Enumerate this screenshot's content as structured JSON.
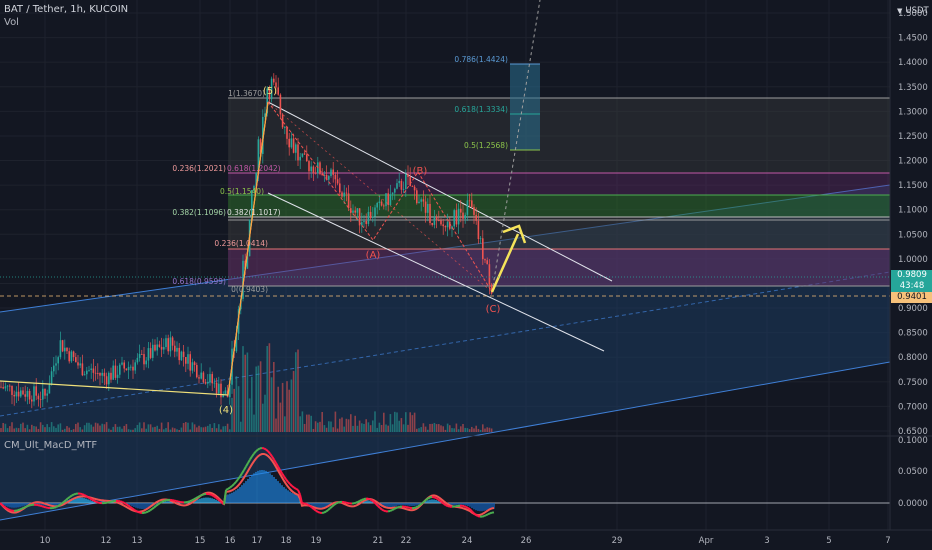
{
  "header": {
    "symbol_line": "BAT / Tether, 1h, KUCOIN",
    "vol_label": "Vol",
    "indicator_label": "CM_Ult_MacD_MTF"
  },
  "price_axis": {
    "currency": "USDT",
    "ticks": [
      "1.5000",
      "1.4500",
      "1.4000",
      "1.3500",
      "1.3000",
      "1.2500",
      "1.2000",
      "1.1500",
      "1.1000",
      "1.0500",
      "1.0000",
      "0.9500",
      "0.9000",
      "0.8500",
      "0.8000",
      "0.7500",
      "0.7000",
      "0.6500"
    ],
    "current_price": "0.9809",
    "countdown": "43:48",
    "marked_price": "0.9401"
  },
  "macd_axis": {
    "ticks": [
      "0.1000",
      "0.0500",
      "0.0000"
    ]
  },
  "time_axis": {
    "ticks": [
      "10",
      "12",
      "13",
      "15",
      "16",
      "17",
      "18",
      "19",
      "21",
      "22",
      "24",
      "26",
      "29",
      "Apr",
      "3",
      "5",
      "7"
    ]
  },
  "waves": {
    "w4": "(4)",
    "w5": "(5)",
    "wA": "(A)",
    "wB": "(B)",
    "wC": "(C)"
  },
  "fib_labels": {
    "top": "1(1.3670)",
    "f236": "0.236(1.2021)",
    "f618_inner": "0.618(1.2042)",
    "f5": "0.5(1.1540)",
    "f382": "0.382(1.1096)",
    "f382_inner": "0.382(1.1017)",
    "f236_inner": "0.236(1.0414)",
    "f618_low": "0.618(0.9599)",
    "f0_low": "0(0.9403)",
    "t786": "0.786(1.4424)",
    "t618": "0.618(1.3334)",
    "t5": "0.5(1.2568)"
  },
  "colors": {
    "background": "#131722",
    "up": "#26a69a",
    "down": "#ef5350",
    "arrow": "#f5e35a",
    "current_price_tag": "#26a69a",
    "marked_price_tag": "#f7c17a"
  },
  "chart_data": {
    "type": "candlestick",
    "symbol": "BAT / Tether",
    "interval": "1h",
    "exchange": "KUCOIN",
    "ylim": [
      0.645,
      1.515
    ],
    "price_path": [
      {
        "t": "Mar 9",
        "p": 0.74
      },
      {
        "t": "Mar 10",
        "p": 0.72
      },
      {
        "t": "Mar 10 12h",
        "p": 0.83
      },
      {
        "t": "Mar 11",
        "p": 0.78
      },
      {
        "t": "Mar 12",
        "p": 0.76
      },
      {
        "t": "Mar 13",
        "p": 0.79
      },
      {
        "t": "Mar 14",
        "p": 0.83
      },
      {
        "t": "Mar 15",
        "p": 0.77
      },
      {
        "t": "Mar 16",
        "p": 0.72
      },
      {
        "t": "Mar 17",
        "p": 1.367
      },
      {
        "t": "Mar 18",
        "p": 1.2
      },
      {
        "t": "Mar 19",
        "p": 1.17
      },
      {
        "t": "Mar 20",
        "p": 1.08
      },
      {
        "t": "Mar 21",
        "p": 1.1
      },
      {
        "t": "Mar 22",
        "p": 1.16
      },
      {
        "t": "Mar 23",
        "p": 1.06
      },
      {
        "t": "Mar 24",
        "p": 1.11
      },
      {
        "t": "Mar 25",
        "p": 0.94
      }
    ],
    "current_price": 0.9809,
    "marked_level": 0.9401,
    "fibonacci_retracement": {
      "from": 1.367,
      "to": 0.9403,
      "levels": [
        {
          "ratio": 1,
          "price": 1.367
        },
        {
          "ratio": 0.618,
          "price": 1.2042
        },
        {
          "ratio": 0.382,
          "price": 1.1017
        },
        {
          "ratio": 0.236,
          "price": 1.0414
        },
        {
          "ratio": 0,
          "price": 0.9403
        }
      ]
    },
    "fibonacci_extension_targets": [
      {
        "ratio": 0.786,
        "price": 1.4424
      },
      {
        "ratio": 0.618,
        "price": 1.3334
      },
      {
        "ratio": 0.5,
        "price": 1.2568
      }
    ],
    "elliott_waves": [
      {
        "label": "(4)",
        "price": 0.72
      },
      {
        "label": "(5)",
        "price": 1.367
      },
      {
        "label": "(A)",
        "price": 1.055
      },
      {
        "label": "(B)",
        "price": 1.16
      },
      {
        "label": "(C)",
        "price": 0.94
      }
    ],
    "macd": {
      "ylim": [
        -0.04,
        0.105
      ],
      "ticks": [
        0.1,
        0.05,
        0.0
      ]
    }
  }
}
